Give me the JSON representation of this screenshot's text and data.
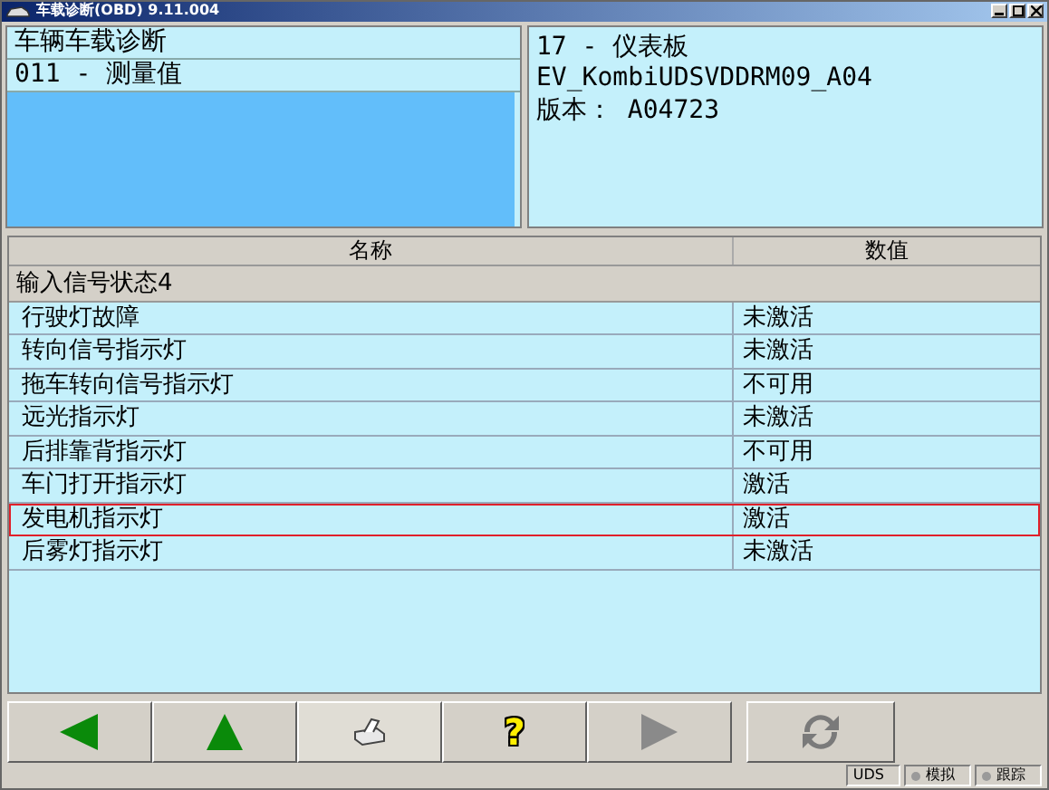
{
  "window": {
    "title": "车载诊断(OBD) 9.11.004"
  },
  "left_panel": {
    "title": "车辆车载诊断",
    "subtitle": "011 - 测量值"
  },
  "right_panel": {
    "lines": [
      "17 - 仪表板",
      "EV_KombiUDSVDDRM09_A04",
      "版本： A04723"
    ]
  },
  "table": {
    "columns": [
      "名称",
      "数值"
    ],
    "group": "输入信号状态4",
    "rows": [
      {
        "name": "行驶灯故障",
        "value": "未激活",
        "highlighted": false
      },
      {
        "name": "转向信号指示灯",
        "value": "未激活",
        "highlighted": false
      },
      {
        "name": "拖车转向信号指示灯",
        "value": "不可用",
        "highlighted": false
      },
      {
        "name": "远光指示灯",
        "value": "未激活",
        "highlighted": false
      },
      {
        "name": "后排靠背指示灯",
        "value": "不可用",
        "highlighted": false
      },
      {
        "name": "车门打开指示灯",
        "value": "激活",
        "highlighted": false
      },
      {
        "name": "发电机指示灯",
        "value": "激活",
        "highlighted": true
      },
      {
        "name": "后雾灯指示灯",
        "value": "未激活",
        "highlighted": false
      }
    ]
  },
  "toolbar": [
    {
      "kind": "back",
      "disabled": false
    },
    {
      "kind": "up",
      "disabled": false
    },
    {
      "kind": "print",
      "disabled": false
    },
    {
      "kind": "help",
      "label": "?",
      "disabled": false
    },
    {
      "kind": "forward",
      "disabled": true
    },
    {
      "kind": "refresh",
      "disabled": false
    }
  ],
  "status_bar": [
    "UDS",
    "模拟",
    "跟踪"
  ]
}
